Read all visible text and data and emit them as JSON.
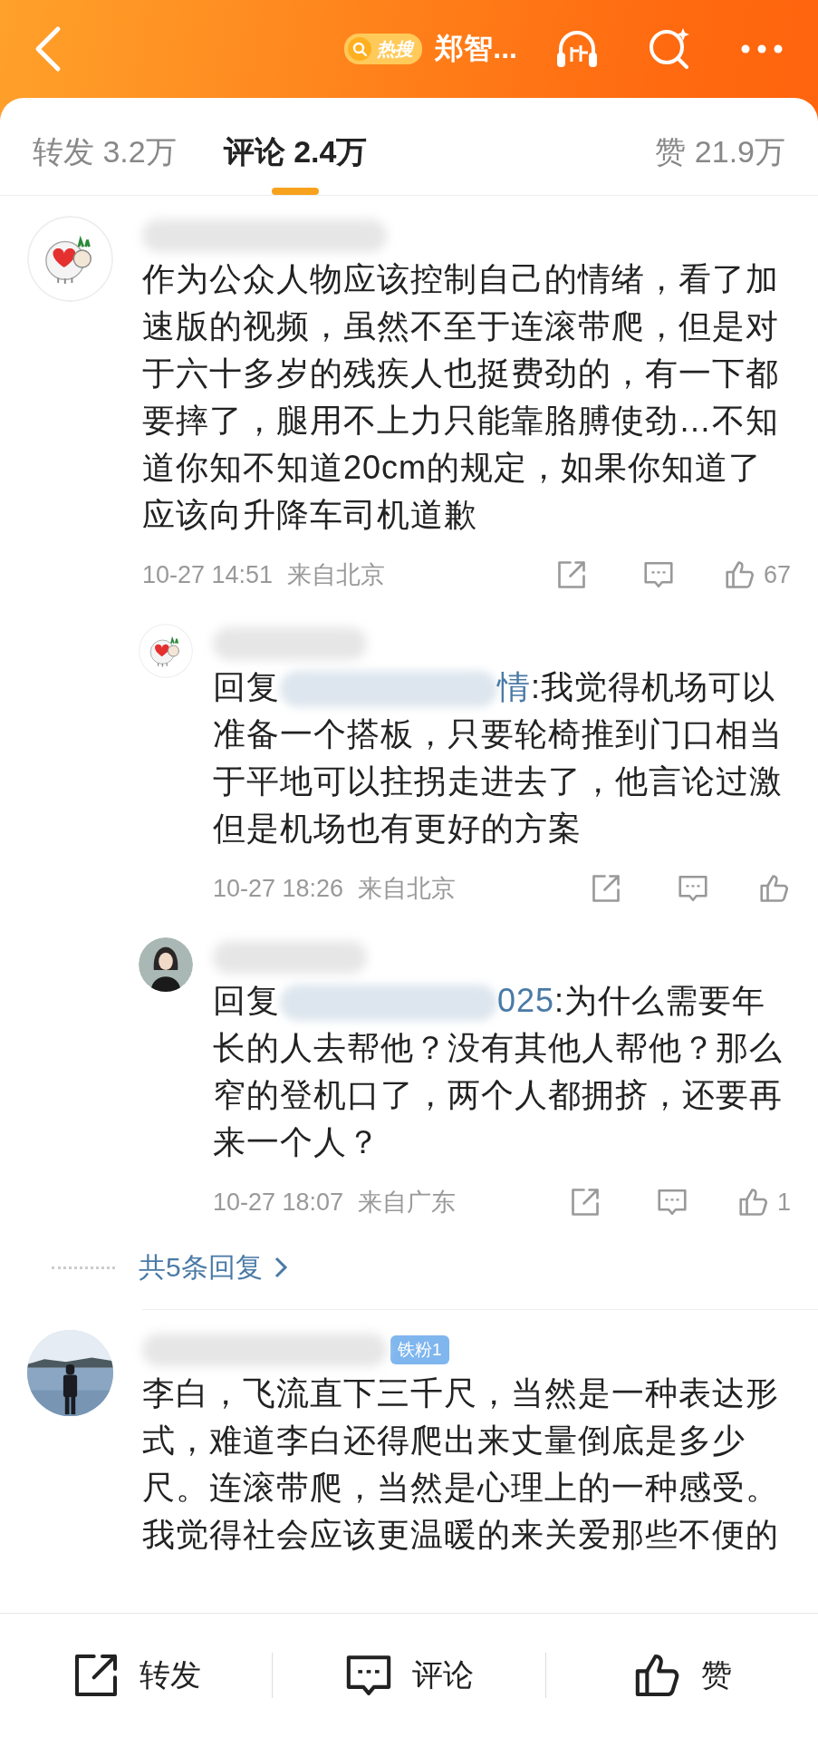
{
  "header": {
    "hot_badge": "热搜",
    "title": "郑智..."
  },
  "tabs": [
    {
      "label": "转发 3.2万",
      "selected": false
    },
    {
      "label": "评论 2.4万",
      "selected": true
    },
    {
      "label": "赞 21.9万",
      "selected": false
    }
  ],
  "comments": [
    {
      "avatar": {
        "kind": "sheep"
      },
      "text": "作为公众人物应该控制自己的情绪，看了加速版的视频，虽然不至于连滚带爬，但是对于六十多岁的残疾人也挺费劲的，有一下都要摔了，腿用不上力只能靠胳膊使劲…不知道你知不知道20cm的规定，如果你知道了应该向升降车司机道歉",
      "time": "10-27 14:51",
      "location": "来自北京",
      "like_count": "67",
      "replies": [
        {
          "avatar": {
            "kind": "sheep"
          },
          "prefix": "回复",
          "mention": "情",
          "text": ":我觉得机场可以准备一个搭板，只要轮椅推到门口相当于平地可以拄拐走进去了，他言论过激但是机场也有更好的方案",
          "time": "10-27 18:26",
          "location": "来自北京"
        },
        {
          "avatar": {
            "kind": "portrait"
          },
          "prefix": "回复",
          "mention": "025",
          "text": ":为什么需要年长的人去帮他？没有其他人帮他？那么窄的登机口了，两个人都拥挤，还要再来一个人？",
          "time": "10-27 18:07",
          "location": "来自广东",
          "like_count": "1"
        }
      ],
      "more_replies": "共5条回复"
    },
    {
      "badge": "铁粉1",
      "text": "李白，飞流直下三千尺，当然是一种表达形式，难道李白还得爬出来丈量倒底是多少尺。连滚带爬，当然是心理上的一种感受。我觉得社会应该更温暖的来关爱那些不便的"
    }
  ],
  "footer": [
    {
      "kind": "share",
      "label": "转发"
    },
    {
      "kind": "comment",
      "label": "评论"
    },
    {
      "kind": "like",
      "label": "赞"
    }
  ]
}
